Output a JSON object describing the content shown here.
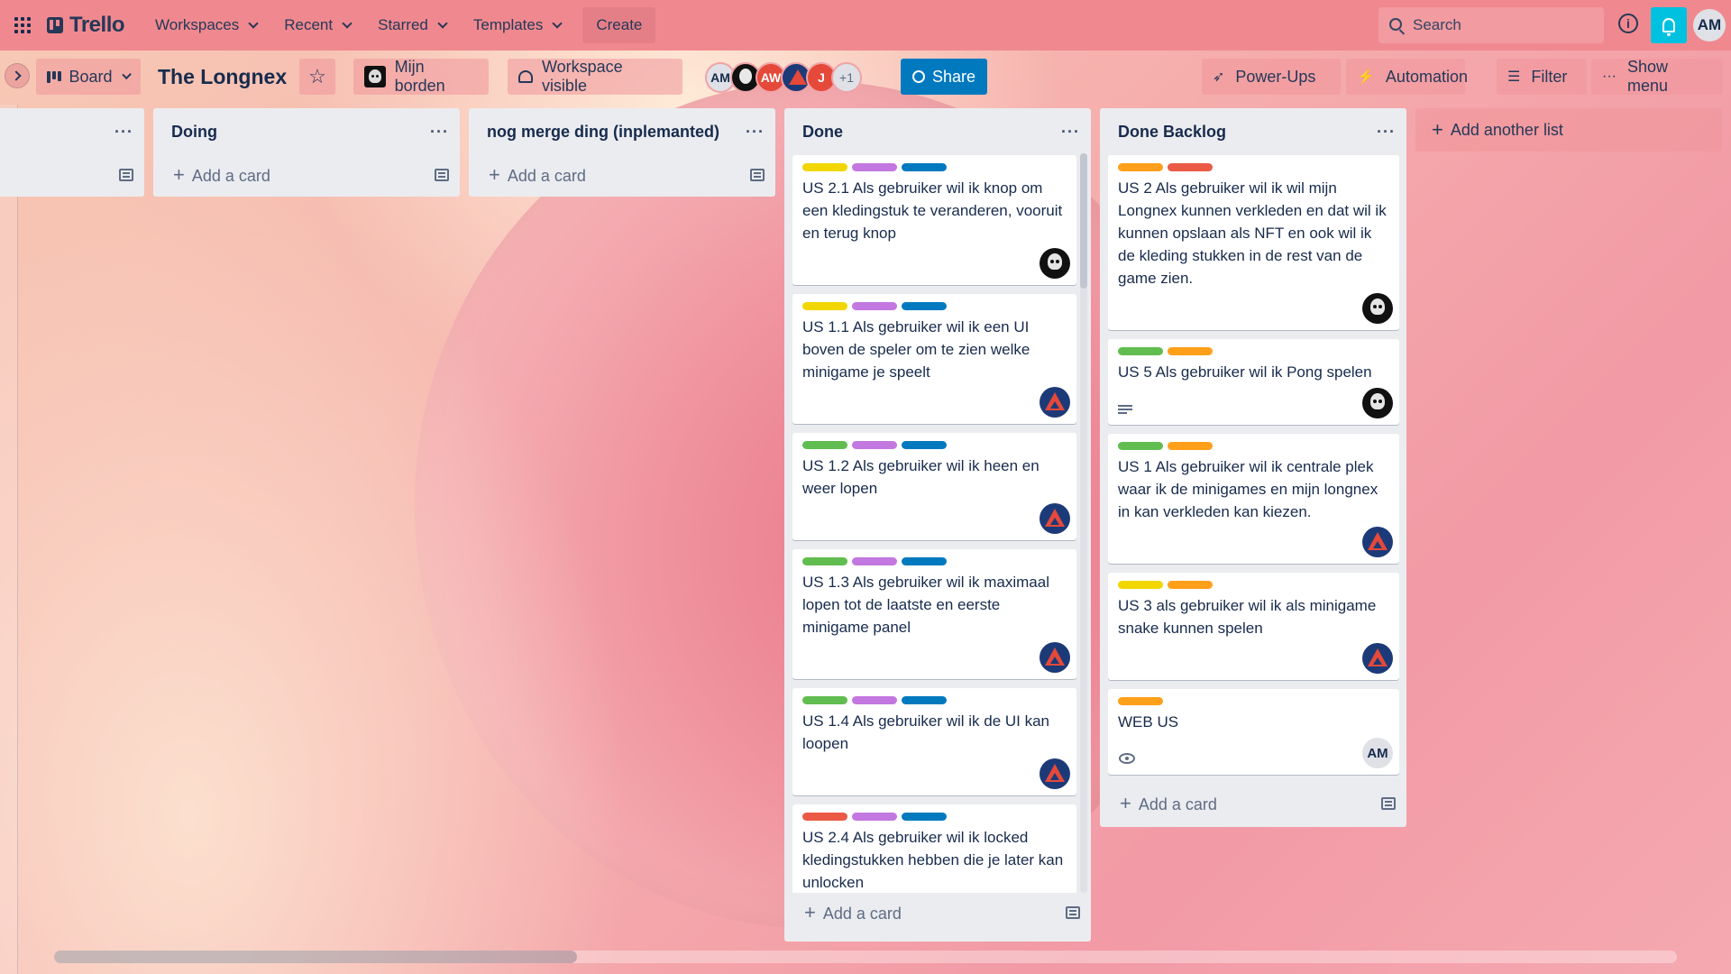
{
  "nav": {
    "logo": "Trello",
    "items": [
      "Workspaces",
      "Recent",
      "Starred",
      "Templates"
    ],
    "create": "Create",
    "search_placeholder": "Search",
    "info": "i",
    "avatar": "AM"
  },
  "board": {
    "view": "Board",
    "title": "The Longnex",
    "workspace_name": "Mijn borden",
    "visibility": "Workspace visible",
    "members": [
      "AM",
      "",
      "AW",
      "",
      "J"
    ],
    "more_members": "+1",
    "share": "Share",
    "powerups": "Power-Ups",
    "automation": "Automation",
    "filter": "Filter",
    "menu": "Show menu"
  },
  "colors": {
    "yellow": "#f2d600",
    "purple": "#c377e0",
    "blue": "#0079bf",
    "green": "#61bd4f",
    "red": "#eb5a46",
    "orange": "#ff9f1a"
  },
  "lists": {
    "doing": {
      "title": "Doing",
      "add": "Add a card"
    },
    "merge": {
      "title": "nog merge ding (inplemanted)",
      "add": "Add a card"
    },
    "first": {
      "add": ""
    },
    "done": {
      "title": "Done",
      "add": "Add a card",
      "cards": [
        {
          "title": "US 2.1 Als gebruiker wil ik knop om een kledingstuk te veranderen, vooruit en terug knop"
        },
        {
          "title": "US 1.1 Als gebruiker wil ik een UI boven de speler om te zien welke minigame je speelt"
        },
        {
          "title": "US 1.2 Als gebruiker wil ik heen en weer lopen"
        },
        {
          "title": "US 1.3 Als gebruiker wil ik maximaal lopen tot de laatste en eerste minigame panel"
        },
        {
          "title": "US 1.4 Als gebruiker wil ik de UI kan loopen"
        },
        {
          "title": "US 2.4 Als gebruiker wil ik locked kledingstukken hebben die je later kan unlocken"
        }
      ]
    },
    "backlog": {
      "title": "Done Backlog",
      "add": "Add a card",
      "cards": [
        {
          "title": "US 2 Als gebruiker wil ik wil mijn Longnex kunnen verkleden en dat wil ik kunnen opslaan als NFT en ook wil ik de kleding stukken in de rest van de game zien."
        },
        {
          "title": "US 5 Als gebruiker wil ik Pong spelen"
        },
        {
          "title": "US 1 Als gebruiker wil ik centrale plek waar ik de minigames en mijn longnex in kan verkleden kan kiezen."
        },
        {
          "title": "US 3 als gebruiker wil ik als minigame snake kunnen spelen"
        },
        {
          "title": "WEB US",
          "member": "AM"
        }
      ]
    },
    "add_list": "Add another list"
  }
}
